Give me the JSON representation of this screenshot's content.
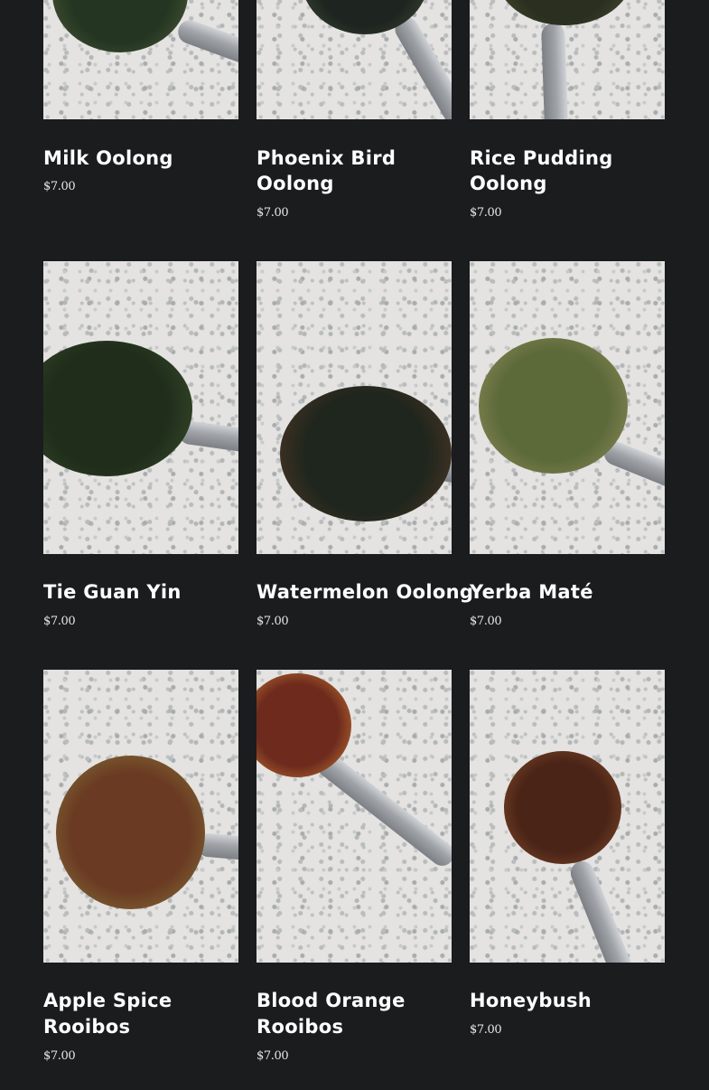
{
  "products": [
    {
      "name_line1": "Milk Oolong",
      "name_line2": "",
      "price": "$7.00",
      "image_icon": "tea-leaves-photo-icon"
    },
    {
      "name_line1": "Phoenix Bird",
      "name_line2": "Oolong",
      "price": "$7.00",
      "image_icon": "tea-leaves-photo-icon"
    },
    {
      "name_line1": "Rice Pudding",
      "name_line2": "Oolong",
      "price": "$7.00",
      "image_icon": "tea-leaves-photo-icon"
    },
    {
      "name_line1": "Tie Guan Yin",
      "name_line2": "",
      "price": "$7.00",
      "image_icon": "tea-leaves-photo-icon"
    },
    {
      "name_line1": "Watermelon Oolong",
      "name_line2": "",
      "price": "$7.00",
      "image_icon": "tea-leaves-photo-icon"
    },
    {
      "name_line1": "Yerba Maté",
      "name_line2": "",
      "price": "$7.00",
      "image_icon": "tea-leaves-photo-icon"
    },
    {
      "name_line1": "Apple Spice",
      "name_line2": "Rooibos",
      "price": "$7.00",
      "image_icon": "tea-leaves-photo-icon"
    },
    {
      "name_line1": "Blood Orange",
      "name_line2": "Rooibos",
      "price": "$7.00",
      "image_icon": "tea-leaves-photo-icon"
    },
    {
      "name_line1": "Honeybush",
      "name_line2": "",
      "price": "$7.00",
      "image_icon": "tea-leaves-photo-icon"
    }
  ],
  "colors": {
    "page_background": "#1b1c1e",
    "text": "#ffffff",
    "countertop": "#e4e3e1"
  }
}
